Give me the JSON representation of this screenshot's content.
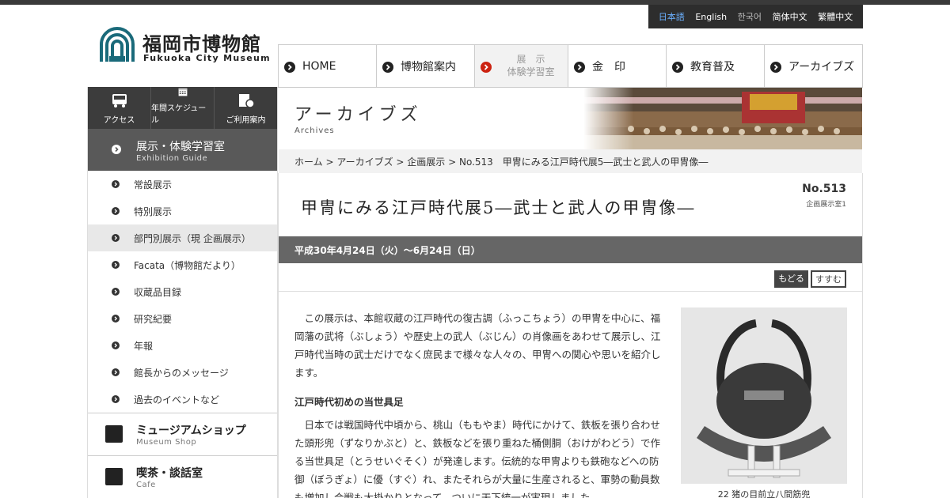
{
  "languages": [
    {
      "label": "日本語",
      "state": "active"
    },
    {
      "label": "English",
      "state": "normal"
    },
    {
      "label": "한국어",
      "state": "dim"
    },
    {
      "label": "简体中文",
      "state": "normal"
    },
    {
      "label": "繁體中文",
      "state": "normal"
    }
  ],
  "logo": {
    "jp": "福岡市博物館",
    "en": "Fukuoka City Museum"
  },
  "quick_links": [
    {
      "label": "アクセス",
      "icon": "bus-icon"
    },
    {
      "label": "年間スケジュール",
      "icon": "calendar-icon"
    },
    {
      "label": "ご利用案内",
      "icon": "info-icon"
    }
  ],
  "side_section": {
    "title": "展示・体験学習室",
    "subtitle": "Exhibition Guide"
  },
  "side_items": [
    {
      "label": "常設展示",
      "current": false
    },
    {
      "label": "特別展示",
      "current": false
    },
    {
      "label": "部門別展示（現 企画展示）",
      "current": true
    },
    {
      "label": "Facata（博物館だより）",
      "current": false
    },
    {
      "label": "収蔵品目録",
      "current": false
    },
    {
      "label": "研究紀要",
      "current": false
    },
    {
      "label": "年報",
      "current": false
    },
    {
      "label": "館長からのメッセージ",
      "current": false
    },
    {
      "label": "過去のイベントなど",
      "current": false
    }
  ],
  "shop": {
    "title": "ミュージアムショップ",
    "subtitle": "Museum Shop"
  },
  "cafe": {
    "title": "喫茶・談話室",
    "subtitle": "Cafe"
  },
  "global_nav": [
    {
      "label": "HOME",
      "active": false
    },
    {
      "label": "博物館案内",
      "active": false
    },
    {
      "label": "展　示\n体験学習室",
      "active": true
    },
    {
      "label": "金　印",
      "active": false
    },
    {
      "label": "教育普及",
      "active": false
    },
    {
      "label": "アーカイブズ",
      "active": false
    }
  ],
  "banner": {
    "title": "アーカイブズ",
    "subtitle": "Archives"
  },
  "breadcrumb": "ホーム > アーカイブズ > 企画展示 > No.513　甲冑にみる江戸時代展5―武士と武人の甲冑像―",
  "exhibit": {
    "title": "甲冑にみる江戸時代展5―武士と武人の甲冑像―",
    "number": "No.513",
    "room": "企画展示室1",
    "period": "平成30年4月24日（火）～6月24日（日）",
    "prev_label": "もどる",
    "next_label": "すすむ",
    "intro": "この展示は、本館収蔵の江戸時代の復古調（ふっこちょう）の甲冑を中心に、福岡藩の武将（ぶしょう）や歴史上の武人（ぶじん）の肖像画をあわせて展示し、江戸時代当時の武士だけでなく庶民まで様々な人々の、甲冑への関心や思いを紹介します。",
    "heading1": "江戸時代初めの当世具足",
    "para1": "日本では戦国時代中頃から、桃山（ももやま）時代にかけて、鉄板を張り合わせた頭形兜（ずなりかぶと）と、鉄板などを張り重ねた桶側胴（おけがわどう）で作る当世具足（とうせいぐそく）が発達します。伝統的な甲冑よりも鉄砲などへの防御（ぼうぎょ）に優（すぐ）れ、またそれらが大量に生産されると、軍勢の動員数も増加し合戦も大掛かりとなって、ついに天下統一が実現しました。",
    "figure_caption": "22 猪の目前立八間筋兜"
  },
  "colors": {
    "dark": "#3c3c3c",
    "mid": "#595959",
    "period_bar": "#666666",
    "lang_active": "#6bb0ff",
    "brand_teal": "#1a6a7a"
  }
}
